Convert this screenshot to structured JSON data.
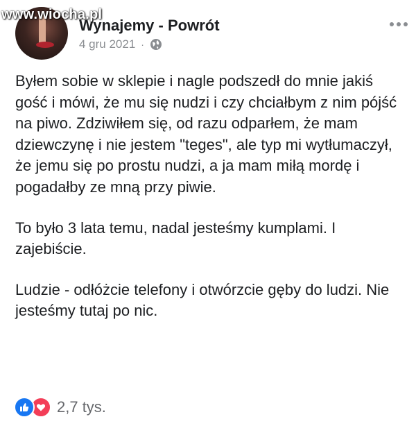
{
  "watermark": {
    "text": "www.wiocha.pl"
  },
  "post": {
    "page_name": "Wynajemy - Powrót",
    "date": "4 gru 2021",
    "separator": "·",
    "paragraphs": [
      "Byłem sobie w sklepie i nagle podszedł do mnie jakiś gość i mówi, że mu się nudzi i czy chciałbym z nim pójść na piwo. Zdziwiłem się, od razu odparłem, że mam dziewczynę i nie jestem \"teges\", ale typ mi wytłumaczył, że jemu się po prostu nudzi, a ja mam miłą mordę i pogadałby ze mną przy piwie.",
      "To było 3 lata temu, nadal jesteśmy kumplami. I zajebiście.",
      "Ludzie - odłóżcie telefony i otwórzcie gęby do ludzi. Nie jesteśmy tutaj po nic."
    ],
    "reaction_count": "2,7 tys.",
    "icons": {
      "privacy": "globe-icon",
      "menu": "more-options-icon",
      "reactions": [
        "like-icon",
        "love-icon"
      ]
    },
    "colors": {
      "like": "#1877f2",
      "love": "#f33e58",
      "meta_text": "#8a8d91"
    }
  }
}
